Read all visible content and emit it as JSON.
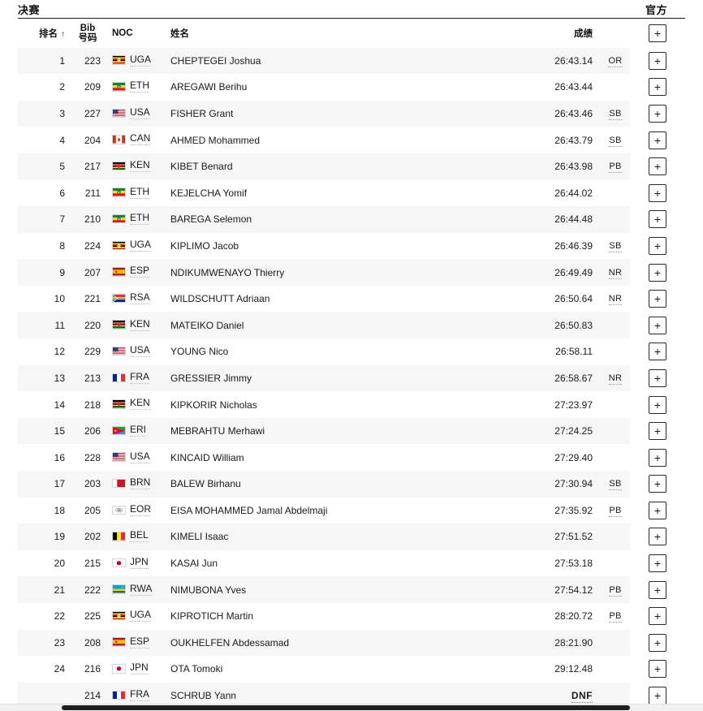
{
  "header": {
    "phase_title": "决赛",
    "official_label": "官方"
  },
  "columns": {
    "rank": "排名",
    "sort_arrow": "↑",
    "bib_line1": "Bib",
    "bib_line2": "号码",
    "noc": "NOC",
    "name": "姓名",
    "result": "成绩",
    "mark": "",
    "expand": ""
  },
  "expand_symbol": "+",
  "rows": [
    {
      "rank": "1",
      "bib": "223",
      "noc": "UGA",
      "flag": "UGA",
      "name": "CHEPTEGEI Joshua",
      "result": "26:43.14",
      "mark": "OR"
    },
    {
      "rank": "2",
      "bib": "209",
      "noc": "ETH",
      "flag": "ETH",
      "name": "AREGAWI Berihu",
      "result": "26:43.44",
      "mark": ""
    },
    {
      "rank": "3",
      "bib": "227",
      "noc": "USA",
      "flag": "USA",
      "name": "FISHER Grant",
      "result": "26:43.46",
      "mark": "SB"
    },
    {
      "rank": "4",
      "bib": "204",
      "noc": "CAN",
      "flag": "CAN",
      "name": "AHMED Mohammed",
      "result": "26:43.79",
      "mark": "SB"
    },
    {
      "rank": "5",
      "bib": "217",
      "noc": "KEN",
      "flag": "KEN",
      "name": "KIBET Benard",
      "result": "26:43.98",
      "mark": "PB"
    },
    {
      "rank": "6",
      "bib": "211",
      "noc": "ETH",
      "flag": "ETH",
      "name": "KEJELCHA Yomif",
      "result": "26:44.02",
      "mark": ""
    },
    {
      "rank": "7",
      "bib": "210",
      "noc": "ETH",
      "flag": "ETH",
      "name": "BAREGA Selemon",
      "result": "26:44.48",
      "mark": ""
    },
    {
      "rank": "8",
      "bib": "224",
      "noc": "UGA",
      "flag": "UGA",
      "name": "KIPLIMO Jacob",
      "result": "26:46.39",
      "mark": "SB"
    },
    {
      "rank": "9",
      "bib": "207",
      "noc": "ESP",
      "flag": "ESP",
      "name": "NDIKUMWENAYO Thierry",
      "result": "26:49.49",
      "mark": "NR"
    },
    {
      "rank": "10",
      "bib": "221",
      "noc": "RSA",
      "flag": "RSA",
      "name": "WILDSCHUTT Adriaan",
      "result": "26:50.64",
      "mark": "NR"
    },
    {
      "rank": "11",
      "bib": "220",
      "noc": "KEN",
      "flag": "KEN",
      "name": "MATEIKO Daniel",
      "result": "26:50.83",
      "mark": ""
    },
    {
      "rank": "12",
      "bib": "229",
      "noc": "USA",
      "flag": "USA",
      "name": "YOUNG Nico",
      "result": "26:58.11",
      "mark": ""
    },
    {
      "rank": "13",
      "bib": "213",
      "noc": "FRA",
      "flag": "FRA",
      "name": "GRESSIER Jimmy",
      "result": "26:58.67",
      "mark": "NR"
    },
    {
      "rank": "14",
      "bib": "218",
      "noc": "KEN",
      "flag": "KEN",
      "name": "KIPKORIR Nicholas",
      "result": "27:23.97",
      "mark": ""
    },
    {
      "rank": "15",
      "bib": "206",
      "noc": "ERI",
      "flag": "ERI",
      "name": "MEBRAHTU Merhawi",
      "result": "27:24.25",
      "mark": ""
    },
    {
      "rank": "16",
      "bib": "228",
      "noc": "USA",
      "flag": "USA",
      "name": "KINCAID William",
      "result": "27:29.40",
      "mark": ""
    },
    {
      "rank": "17",
      "bib": "203",
      "noc": "BRN",
      "flag": "BRN",
      "name": "BALEW Birhanu",
      "result": "27:30.94",
      "mark": "SB"
    },
    {
      "rank": "18",
      "bib": "205",
      "noc": "EOR",
      "flag": "EOR",
      "name": "EISA MOHAMMED Jamal Abdelmaji",
      "result": "27:35.92",
      "mark": "PB"
    },
    {
      "rank": "19",
      "bib": "202",
      "noc": "BEL",
      "flag": "BEL",
      "name": "KIMELI Isaac",
      "result": "27:51.52",
      "mark": ""
    },
    {
      "rank": "20",
      "bib": "215",
      "noc": "JPN",
      "flag": "JPN",
      "name": "KASAI Jun",
      "result": "27:53.18",
      "mark": ""
    },
    {
      "rank": "21",
      "bib": "222",
      "noc": "RWA",
      "flag": "RWA",
      "name": "NIMUBONA Yves",
      "result": "27:54.12",
      "mark": "PB"
    },
    {
      "rank": "22",
      "bib": "225",
      "noc": "UGA",
      "flag": "UGA",
      "name": "KIPROTICH Martin",
      "result": "28:20.72",
      "mark": "PB"
    },
    {
      "rank": "23",
      "bib": "208",
      "noc": "ESP",
      "flag": "ESP",
      "name": "OUKHELFEN Abdessamad",
      "result": "28:21.90",
      "mark": ""
    },
    {
      "rank": "24",
      "bib": "216",
      "noc": "JPN",
      "flag": "JPN",
      "name": "OTA Tomoki",
      "result": "29:12.48",
      "mark": ""
    },
    {
      "rank": "",
      "bib": "214",
      "noc": "FRA",
      "flag": "FRA",
      "name": "SCHRUB Yann",
      "result": "DNF",
      "mark": ""
    }
  ],
  "colors": {
    "row_shade": "#f6f6f6",
    "header_rule": "#1b1b1b",
    "text": "#1a1a1a"
  }
}
